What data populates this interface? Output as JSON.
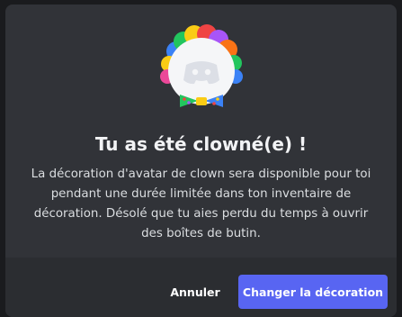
{
  "dialog": {
    "title": "Tu as été clowné(e) !",
    "description": "La décoration d'avatar de clown sera disponible pour toi pendant une durée limitée dans ton inventaire de décoration. Désolé que tu aies perdu du temps à ouvrir des boîtes de butin.",
    "avatar_icon": "clown-discord-avatar-icon"
  },
  "footer": {
    "cancel_label": "Annuler",
    "confirm_label": "Changer la décoration"
  },
  "colors": {
    "modal_bg": "#313338",
    "footer_bg": "#2b2d31",
    "primary_button": "#5865f2",
    "title_text": "#f2f3f5",
    "body_text": "#dbdee1"
  }
}
